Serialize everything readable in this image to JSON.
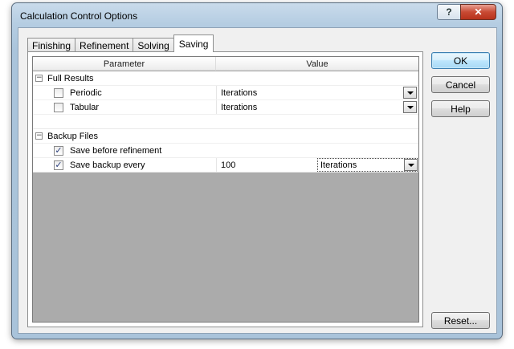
{
  "window": {
    "title": "Calculation Control Options",
    "help_caption": "?",
    "close_caption": "✕"
  },
  "tabs": [
    {
      "label": "Finishing",
      "active": false
    },
    {
      "label": "Refinement",
      "active": false
    },
    {
      "label": "Solving",
      "active": false
    },
    {
      "label": "Saving",
      "active": true
    }
  ],
  "grid": {
    "headers": {
      "parameter": "Parameter",
      "value": "Value"
    },
    "groups": [
      {
        "label": "Full Results",
        "expander": "−",
        "rows": [
          {
            "label": "Periodic",
            "checked": false,
            "value": "Iterations"
          },
          {
            "label": "Tabular",
            "checked": false,
            "value": "Iterations"
          }
        ]
      },
      {
        "label": "Backup Files",
        "expander": "−",
        "rows": [
          {
            "label": "Save before refinement",
            "checked": true
          },
          {
            "label": "Save backup every",
            "checked": true,
            "value": "100",
            "unit": "Iterations"
          }
        ]
      }
    ],
    "check_glyph": "✓"
  },
  "buttons": {
    "ok": "OK",
    "cancel": "Cancel",
    "help": "Help",
    "reset": "Reset..."
  },
  "colors": {
    "accent_border": "#3c7fb1",
    "grid_empty": "#ababab",
    "close_button": "#c84a33"
  }
}
